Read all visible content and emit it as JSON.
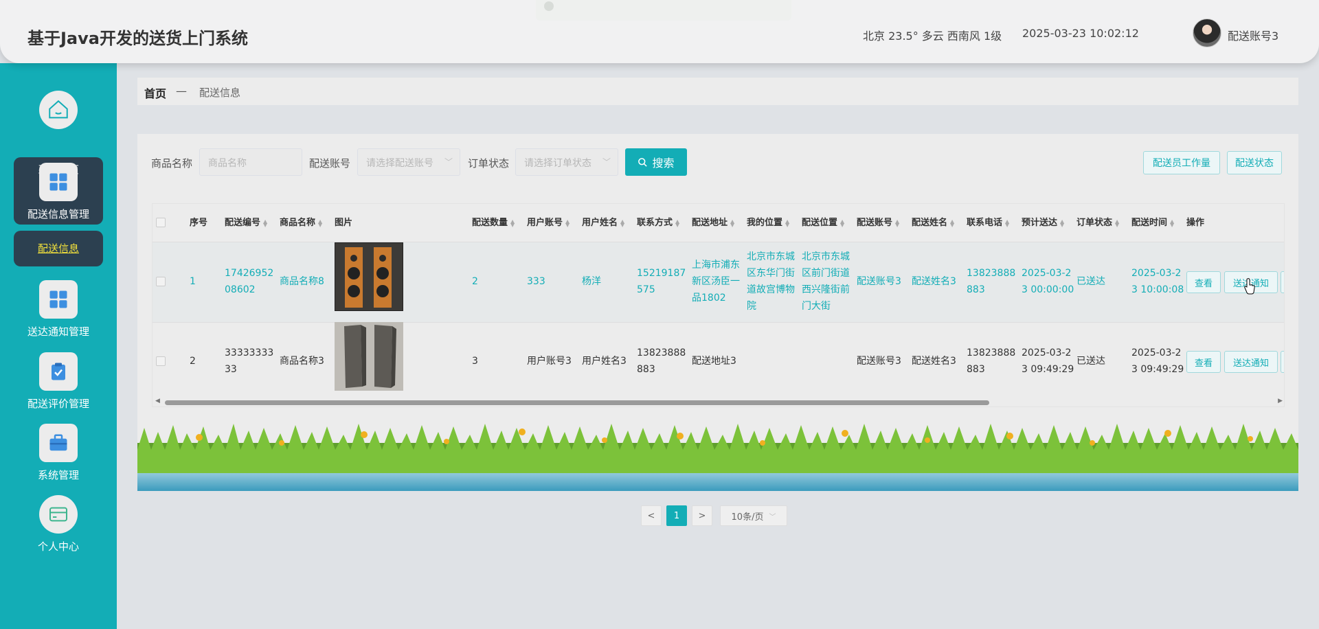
{
  "header": {
    "title": "基于Java开发的送货上门系统",
    "weather": "北京  23.5°  多云  西南风  1级",
    "datetime": "2025-03-23 10:02:12",
    "username": "配送账号3"
  },
  "sidebar": {
    "items": [
      {
        "label": "系统首页"
      },
      {
        "label": "配送信息管理"
      },
      {
        "label": "送达通知管理"
      },
      {
        "label": "配送评价管理"
      },
      {
        "label": "系统管理"
      },
      {
        "label": "个人中心"
      }
    ],
    "sub_item": "配送信息"
  },
  "breadcrumb": {
    "home": "首页",
    "separator": "—",
    "current": "配送信息"
  },
  "search": {
    "product_label": "商品名称",
    "product_placeholder": "商品名称",
    "account_label": "配送账号",
    "account_placeholder": "请选择配送账号",
    "status_label": "订单状态",
    "status_placeholder": "请选择订单状态",
    "search_button": "搜索",
    "workload_button": "配送员工作量",
    "delivery_status_button": "配送状态"
  },
  "table": {
    "columns": [
      "序号",
      "配送编号",
      "商品名称",
      "图片",
      "配送数量",
      "用户账号",
      "用户姓名",
      "联系方式",
      "配送地址",
      "我的位置",
      "配送位置",
      "配送账号",
      "配送姓名",
      "联系电话",
      "预计送达",
      "订单状态",
      "配送时间",
      "操作"
    ],
    "rows": [
      {
        "index": "1",
        "delivery_no": "1742695208602",
        "product": "商品名称8",
        "quantity": "2",
        "user_account": "333",
        "user_name": "杨洋",
        "contact": "15219187575",
        "address": "上海市浦东新区汤臣一品1802",
        "my_location": "北京市东城区东华门街道故宫博物院",
        "delivery_location": "北京市东城区前门街道西兴隆街前门大街",
        "courier_account": "配送账号3",
        "courier_name": "配送姓名3",
        "courier_phone": "13823888883",
        "eta": "2025-03-23 00:00:00",
        "status": "已送达",
        "delivery_time": "2025-03-23 10:00:08",
        "view_button": "查看",
        "notify_button": "送达通知"
      },
      {
        "index": "2",
        "delivery_no": "3333333333",
        "product": "商品名称3",
        "quantity": "3",
        "user_account": "用户账号3",
        "user_name": "用户姓名3",
        "contact": "13823888883",
        "address": "配送地址3",
        "my_location": "",
        "delivery_location": "",
        "courier_account": "配送账号3",
        "courier_name": "配送姓名3",
        "courier_phone": "13823888883",
        "eta": "2025-03-23 09:49:29",
        "status": "已送达",
        "delivery_time": "2025-03-23 09:49:29",
        "view_button": "查看",
        "notify_button": "送达通知"
      }
    ]
  },
  "pagination": {
    "prev": "<",
    "page": "1",
    "next": ">",
    "page_size": "10条/页"
  },
  "colors": {
    "accent": "#13adb6",
    "sidebar_active": "#2c4050",
    "sub_item_text": "#f1e03c"
  },
  "icons": [
    "home-icon",
    "grid-icon",
    "grid-icon",
    "clipboard-check-icon",
    "briefcase-icon",
    "wallet-icon",
    "search-icon",
    "chevron-down-icon",
    "user-avatar"
  ]
}
